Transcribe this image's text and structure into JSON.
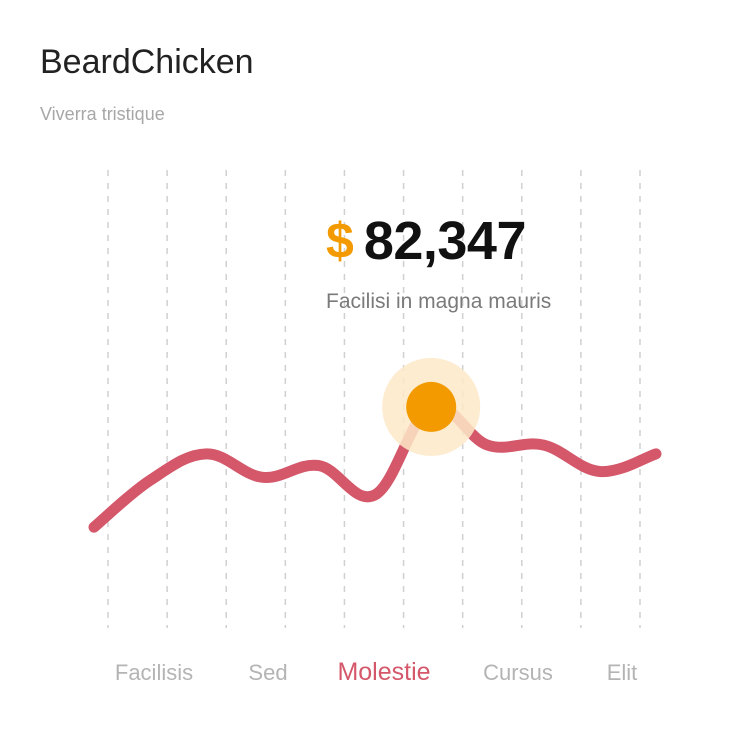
{
  "header": {
    "title": "BeardChicken",
    "subtitle": "Viverra tristique"
  },
  "highlight": {
    "currency_symbol": "$",
    "value": "82,347",
    "caption": "Facilisi in magna mauris"
  },
  "colors": {
    "line": "#d4576a",
    "accent": "#f39a00",
    "halo": "#fde9c8",
    "grid": "#d0d0d0",
    "label": "#b4b4b4",
    "active_label": "#d4576a"
  },
  "chart_data": {
    "type": "line",
    "categories": [
      "Facilisis",
      "Sed",
      "Molestie",
      "Cursus",
      "Elit"
    ],
    "active_category": "Molestie",
    "grid": "vertical-dashed",
    "y_axis_shown": false,
    "values": [
      18,
      34,
      43,
      35,
      39,
      29,
      59,
      46,
      46,
      37,
      43
    ],
    "highlight_index": 6,
    "highlight_value": 82347
  }
}
